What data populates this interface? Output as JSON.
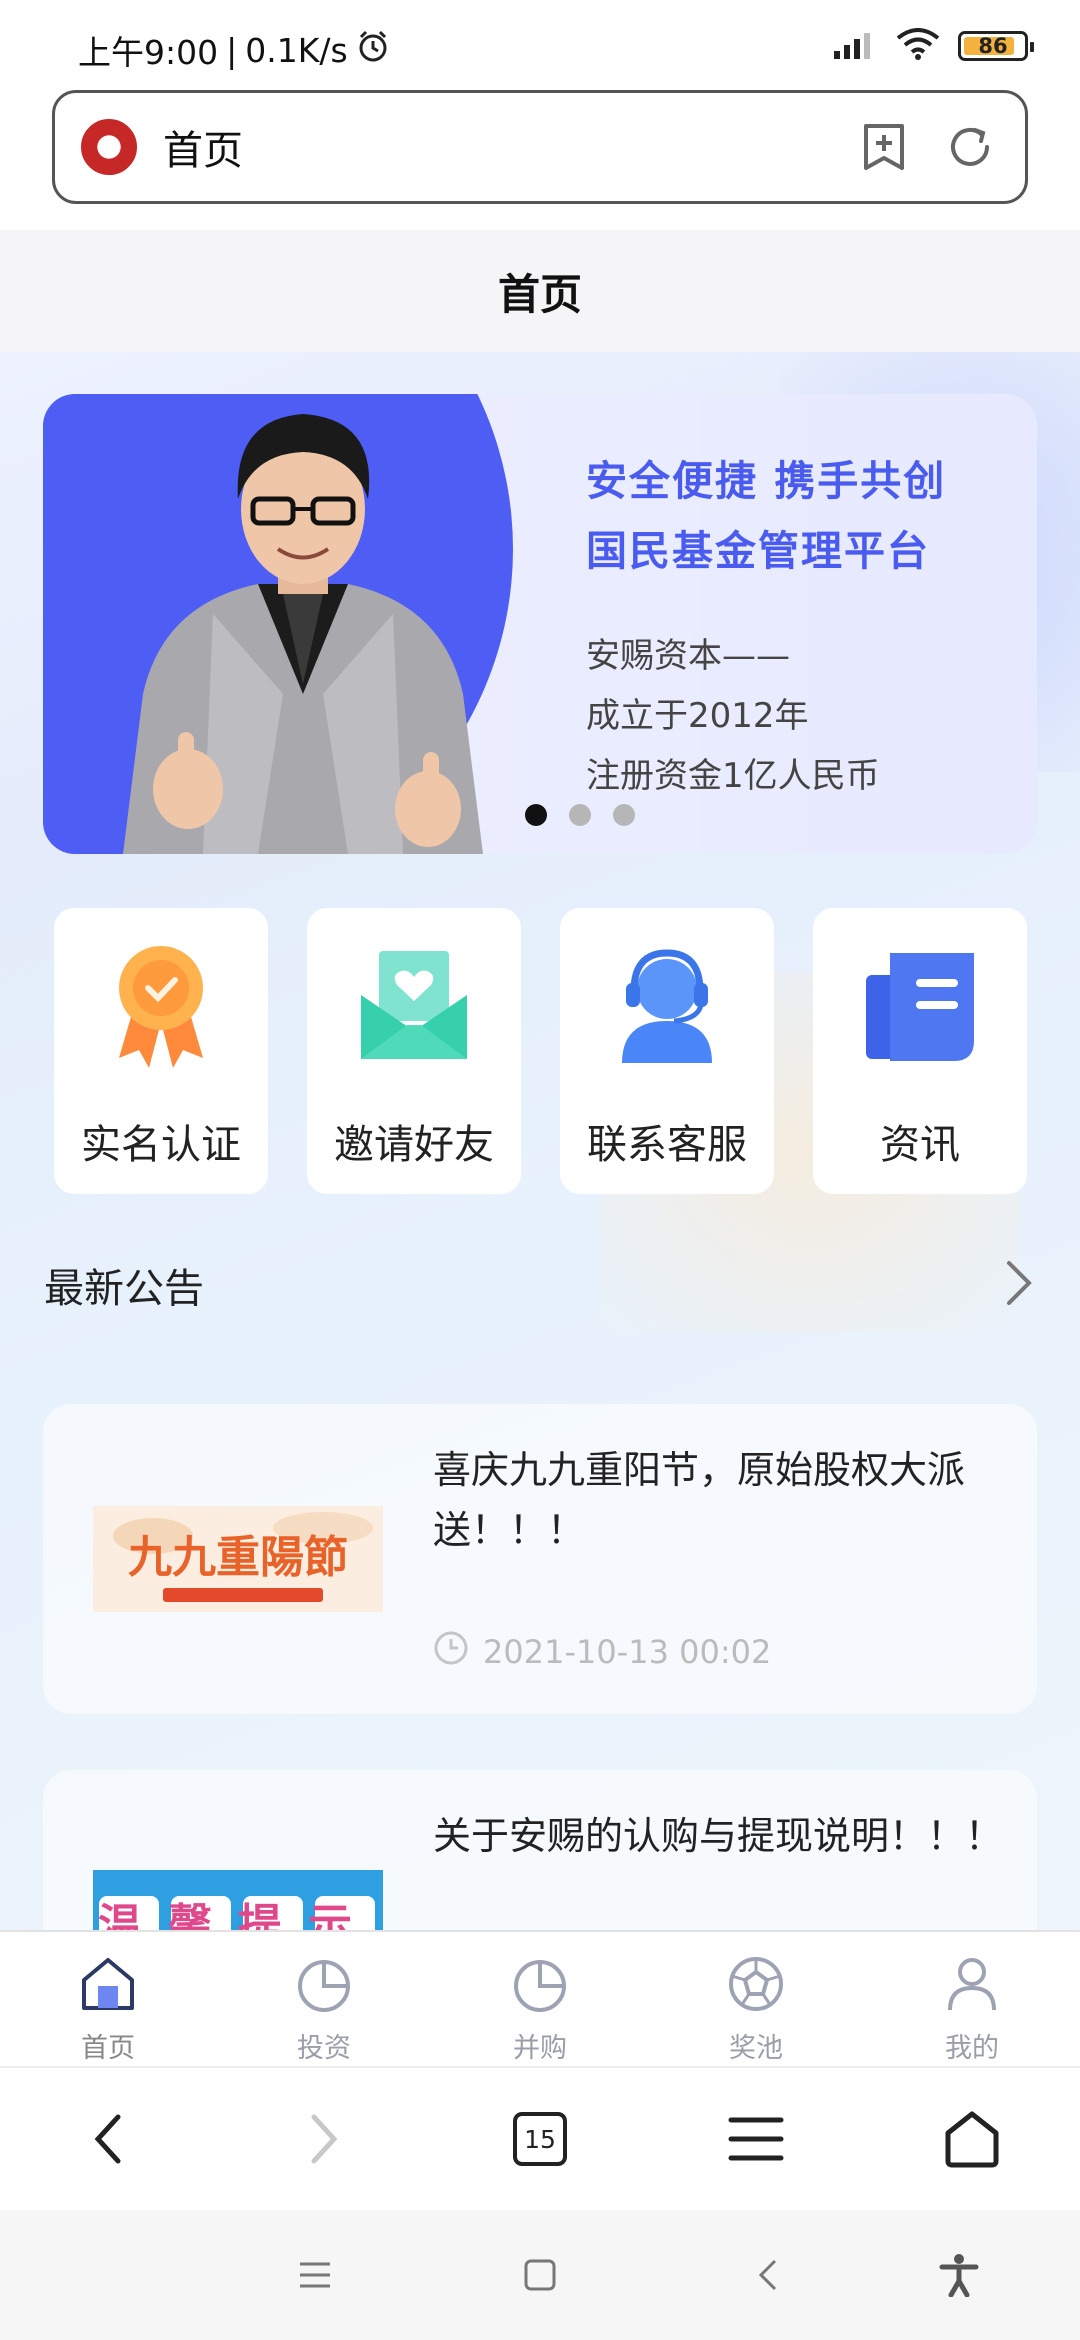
{
  "status_bar": {
    "time": "上午9:00",
    "net_speed": "0.1K/s",
    "battery": "86"
  },
  "url_bar": {
    "title": "首页"
  },
  "page_header": {
    "title": "首页"
  },
  "banner": {
    "headline_1": "安全便捷 携手共创",
    "headline_2": "国民基金管理平台",
    "line_1": "安赐资本——",
    "line_2": "成立于2012年",
    "line_3": "注册资金1亿人民币",
    "active_slide": 1,
    "slide_count": 3
  },
  "quick_actions": [
    {
      "label": "实名认证",
      "icon": "certificate-badge-icon"
    },
    {
      "label": "邀请好友",
      "icon": "invite-envelope-icon"
    },
    {
      "label": "联系客服",
      "icon": "customer-service-icon"
    },
    {
      "label": "资讯",
      "icon": "news-document-icon"
    }
  ],
  "notice": {
    "title": "最新公告"
  },
  "news": [
    {
      "title": "喜庆九九重阳节，原始股权大派送！！！",
      "time": "2021-10-13 00:02",
      "image_text": "九九重陽節"
    },
    {
      "title": "关于安赐的认购与提现说明！！！",
      "image_text": "温馨提示"
    }
  ],
  "tab_bar": [
    {
      "label": "首页",
      "icon": "home-icon",
      "active": true
    },
    {
      "label": "投资",
      "icon": "pie-chart-icon"
    },
    {
      "label": "并购",
      "icon": "pie-chart-icon"
    },
    {
      "label": "奖池",
      "icon": "prize-pool-icon"
    },
    {
      "label": "我的",
      "icon": "user-icon"
    }
  ],
  "browser_bar": {
    "tab_count": "15"
  },
  "colors": {
    "accent": "#4e5ef4",
    "headline": "#4a5cf0",
    "muted": "#9a9ea8"
  }
}
